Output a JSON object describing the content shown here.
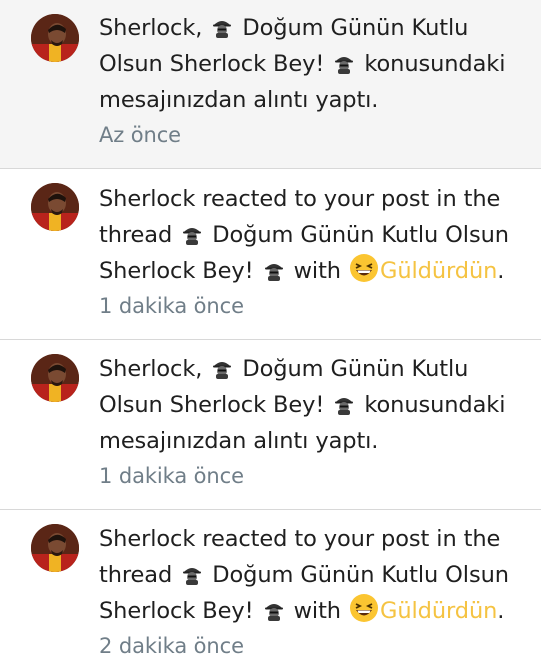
{
  "notifications": [
    {
      "lines": [
        {
          "pre": "Sherlock, ",
          "post": " Doğum Günün Kutlu"
        },
        {
          "pre": "Olsun Sherlock Bey! ",
          "post": " konusundaki"
        },
        {
          "pre": "mesajınızdan alıntı yaptı."
        }
      ],
      "time": "Az önce"
    },
    {
      "lines": [
        {
          "pre": "Sherlock reacted to your post in the"
        },
        {
          "pre": "thread ",
          "post": " Doğum Günün Kutlu Olsun"
        },
        {
          "pre": "Sherlock Bey! ",
          "post": " with ",
          "reaction": "Güldürdün",
          "tail": "."
        }
      ],
      "time": "1 dakika önce"
    },
    {
      "lines": [
        {
          "pre": "Sherlock, ",
          "post": " Doğum Günün Kutlu"
        },
        {
          "pre": "Olsun Sherlock Bey! ",
          "post": " konusundaki"
        },
        {
          "pre": "mesajınızdan alıntı yaptı."
        }
      ],
      "time": "1 dakika önce"
    },
    {
      "lines": [
        {
          "pre": "Sherlock reacted to your post in the"
        },
        {
          "pre": "thread ",
          "post": " Doğum Günün Kutlu Olsun"
        },
        {
          "pre": "Sherlock Bey! ",
          "post": " with ",
          "reaction": "Güldürdün",
          "tail": "."
        }
      ],
      "time": "2 dakika önce"
    }
  ],
  "colors": {
    "unread_bg": "#f5f5f5",
    "text": "#1f1f1f",
    "time": "#707e88",
    "reaction": "#f5c342"
  },
  "icons": {
    "avatar": "user-avatar",
    "spy": "detective-emoji",
    "reaction": "grinning-squinting-face-emoji"
  }
}
